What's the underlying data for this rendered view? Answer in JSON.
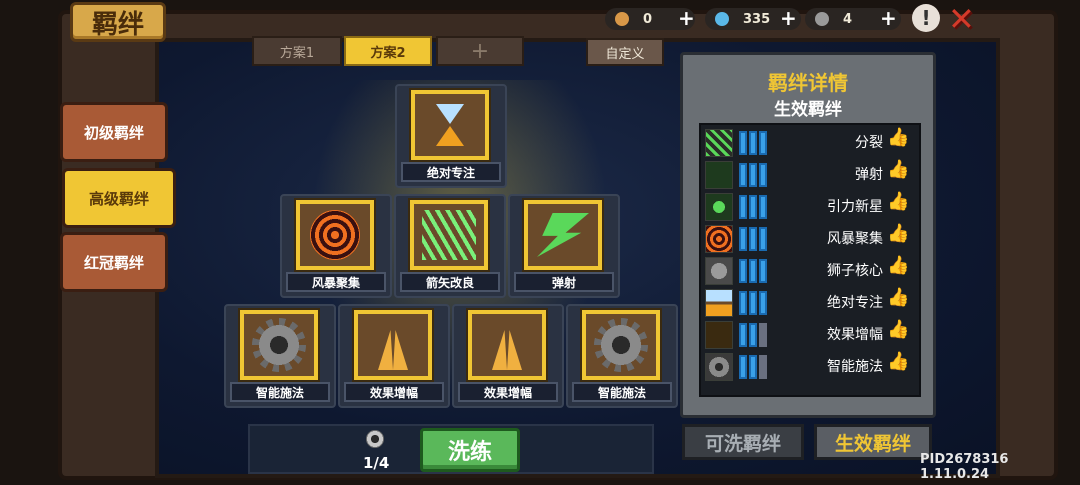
{
  "header": {
    "title": "羁绊",
    "resources": [
      {
        "name": "guitar-icon",
        "value": "0",
        "plus": "+"
      },
      {
        "name": "gem-icon",
        "value": "335",
        "plus": "+"
      },
      {
        "name": "wash-token-icon",
        "value": "4",
        "plus": "+"
      }
    ],
    "alert": "!",
    "close": "✕"
  },
  "sidebar": {
    "tabs": [
      {
        "label": "初级羁绊",
        "active": false
      },
      {
        "label": "高级羁绊",
        "active": true
      },
      {
        "label": "红冠羁绊",
        "active": false
      }
    ]
  },
  "schemes": {
    "items": [
      {
        "label": "方案1",
        "active": false
      },
      {
        "label": "方案2",
        "active": true
      },
      {
        "label": "+",
        "active": false
      }
    ],
    "custom": "自定义"
  },
  "tree": {
    "top": {
      "label": "绝对专注",
      "icon": "hourglass-icon"
    },
    "middle": [
      {
        "label": "风暴聚集",
        "icon": "target-icon"
      },
      {
        "label": "箭矢改良",
        "icon": "arrows-icon"
      },
      {
        "label": "弹射",
        "icon": "bolt-icon"
      }
    ],
    "bottom": [
      {
        "label": "智能施法",
        "icon": "gear-icon"
      },
      {
        "label": "效果增幅",
        "icon": "praying-hands-icon"
      },
      {
        "label": "效果增幅",
        "icon": "praying-hands-icon"
      },
      {
        "label": "智能施法",
        "icon": "gear-icon"
      }
    ]
  },
  "wash": {
    "count": "1/4",
    "button": "洗练"
  },
  "detail": {
    "title": "羁绊详情",
    "subtitle": "生效羁绊",
    "rows": [
      {
        "name": "分裂",
        "level": 3
      },
      {
        "name": "弹射",
        "level": 3
      },
      {
        "name": "引力新星",
        "level": 3
      },
      {
        "name": "风暴聚集",
        "level": 3
      },
      {
        "name": "狮子核心",
        "level": 3
      },
      {
        "name": "绝对专注",
        "level": 3
      },
      {
        "name": "效果增幅",
        "level": 2
      },
      {
        "name": "智能施法",
        "level": 2
      }
    ]
  },
  "bottom_tabs": {
    "washable": "可洗羁绊",
    "active": "生效羁绊"
  },
  "version": "PID2678316 1.11.0.24",
  "colors": {
    "accent": "#f0c634",
    "sidebar": "#a95a36",
    "wash_green": "#5ab85a",
    "bar_blue": "#3aa0e8"
  }
}
